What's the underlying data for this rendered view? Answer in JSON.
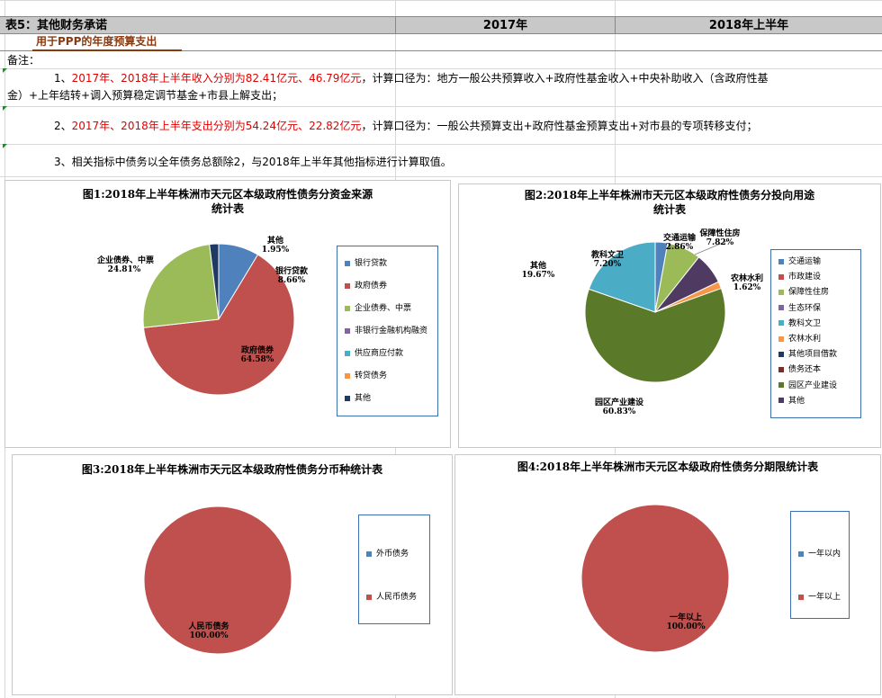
{
  "table": {
    "title": "表5：其他财务承诺",
    "col_2017": "2017年",
    "col_2018h1": "2018年上半年",
    "row1_label": "用于PPP的年度预算支出"
  },
  "notes": {
    "label": "备注：",
    "note1_prefix": "1、",
    "note1_red": "2017年、2018年上半年收入分别为82.41亿元、46.79亿元",
    "note1_rest": "，计算口径为：地方一般公共预算收入+政府性基金收入+中央补助收入（含政府性基",
    "note1_line2": "金）+上年结转+调入预算稳定调节基金+市县上解支出；",
    "note2_prefix": "2、",
    "note2_red": "2017年、2018年上半年支出分别为54.24亿元、22.82亿元",
    "note2_rest": "，计算口径为：一般公共预算支出+政府性基金预算支出+对市县的专项转移支付；",
    "note3": "3、相关指标中债务以全年债务总额除2，与2018年上半年其他指标进行计算取值。"
  },
  "colors": {
    "blue": "#4f81bd",
    "red": "#c0504d",
    "green": "#9bbb59",
    "purple": "#8064a2",
    "teal": "#4bacc6",
    "orange": "#f79646",
    "navy": "#1f3864",
    "maroon": "#7f2a2a",
    "olive": "#5a7a2a",
    "dark_purple": "#4f3b62"
  },
  "chart_data": [
    {
      "type": "pie",
      "title": "图1:2018年上半年株洲市天元区本级政府性债务分资金来源统计表",
      "title_line1": "图1:2018年上半年株洲市天元区本级政府性债务分资金来源",
      "title_line2": "统计表",
      "legend": [
        "银行贷款",
        "政府债券",
        "企业债券、中票",
        "非银行金融机构融资",
        "供应商应付款",
        "转贷债务",
        "其他"
      ],
      "slices": [
        {
          "name": "银行贷款",
          "value": 8.66,
          "label": "银行贷款\n8.66%"
        },
        {
          "name": "政府债券",
          "value": 64.58,
          "label": "政府债券\n64.58%"
        },
        {
          "name": "企业债券、中票",
          "value": 24.81,
          "label": "企业债券、中票\n24.81%"
        },
        {
          "name": "其他",
          "value": 1.95,
          "label": "其他\n1.95%"
        }
      ]
    },
    {
      "type": "pie",
      "title": "图2:2018年上半年株洲市天元区本级政府性债务分投向用途统计表",
      "title_line1": "图2:2018年上半年株洲市天元区本级政府性债务分投向用途",
      "title_line2": "统计表",
      "legend": [
        "交通运输",
        "市政建设",
        "保障性住房",
        "生态环保",
        "教科文卫",
        "农林水利",
        "其他项目借款",
        "债务还本",
        "园区产业建设",
        "其他"
      ],
      "slices": [
        {
          "name": "交通运输",
          "value": 2.86,
          "label": "交通运输\n2.86%"
        },
        {
          "name": "保障性住房",
          "value": 7.82,
          "label": "保障性住房\n7.82%"
        },
        {
          "name": "教科文卫",
          "value": 7.2,
          "label": "教科文卫\n7.20%"
        },
        {
          "name": "农林水利",
          "value": 1.62,
          "label": "农林水利\n1.62%"
        },
        {
          "name": "园区产业建设",
          "value": 60.83,
          "label": "园区产业建设\n60.83%"
        },
        {
          "name": "其他",
          "value": 19.67,
          "label": "其他\n19.67%"
        }
      ]
    },
    {
      "type": "pie",
      "title": "图3:2018年上半年株洲市天元区本级政府性债务分币种统计表",
      "legend": [
        "外币债务",
        "人民币债务"
      ],
      "slices": [
        {
          "name": "人民币债务",
          "value": 100.0,
          "label": "人民币债务\n100.00%"
        }
      ]
    },
    {
      "type": "pie",
      "title": "图4:2018年上半年株洲市天元区本级政府性债务分期限统计表",
      "legend": [
        "一年以内",
        "一年以上"
      ],
      "slices": [
        {
          "name": "一年以上",
          "value": 100.0,
          "label": "一年以上\n100.00%"
        }
      ]
    }
  ]
}
